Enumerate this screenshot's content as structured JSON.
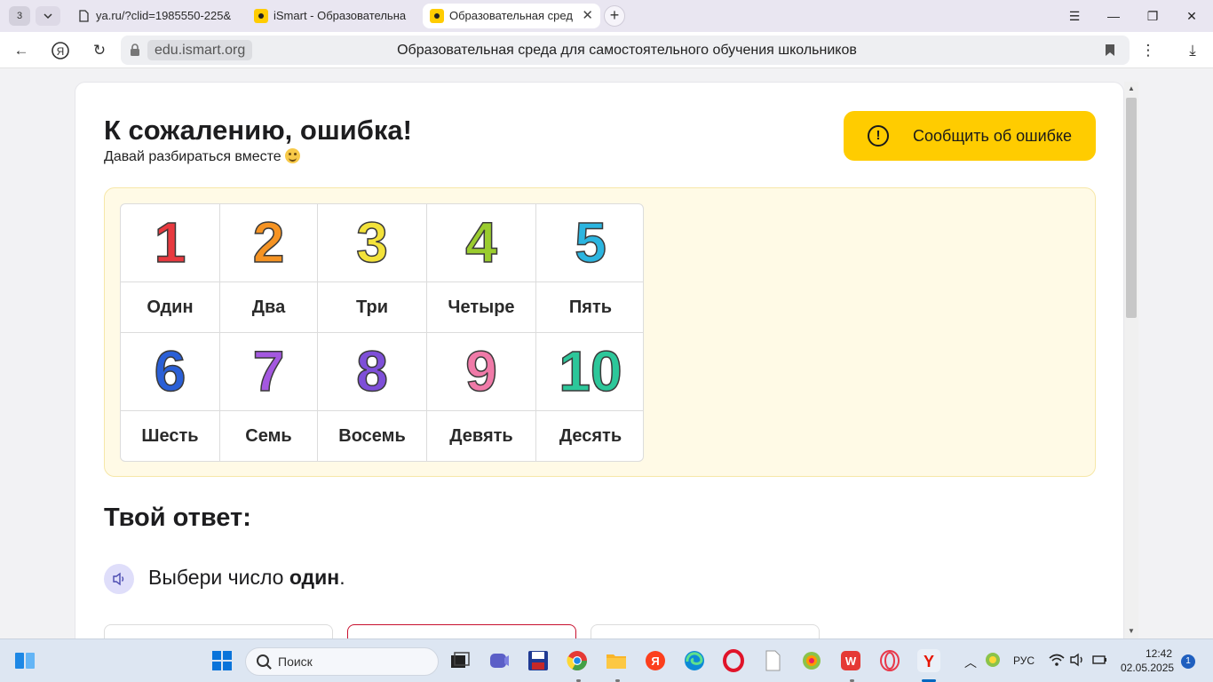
{
  "browser": {
    "tab_count": "3",
    "tabs": [
      {
        "label": "ya.ru/?clid=1985550-225&"
      },
      {
        "label": "iSmart - Образовательна"
      },
      {
        "label": "Образовательная сред"
      }
    ],
    "domain": "edu.ismart.org",
    "page_title": "Образовательная среда для самостоятельного обучения школьников"
  },
  "error": {
    "title": "К сожалению, ошибка!",
    "subtitle": "Давай разбираться вместе",
    "report_button": "Сообщить об ошибке"
  },
  "numbers": {
    "row1": [
      {
        "digit": "1",
        "word": "Один",
        "color": "#e8393f"
      },
      {
        "digit": "2",
        "word": "Два",
        "color": "#f59323"
      },
      {
        "digit": "3",
        "word": "Три",
        "color": "#f3e23a"
      },
      {
        "digit": "4",
        "word": "Четыре",
        "color": "#9acc2e"
      },
      {
        "digit": "5",
        "word": "Пять",
        "color": "#2bb5e0"
      }
    ],
    "row2": [
      {
        "digit": "6",
        "word": "Шесть",
        "color": "#2a5fd6"
      },
      {
        "digit": "7",
        "word": "Семь",
        "color": "#a458e0"
      },
      {
        "digit": "8",
        "word": "Восемь",
        "color": "#7e4fd8"
      },
      {
        "digit": "9",
        "word": "Девять",
        "color": "#f07aa8"
      },
      {
        "digit": "10",
        "word": "Десять",
        "color": "#2cc79a"
      }
    ]
  },
  "answer": {
    "title": "Твой ответ:",
    "question_prefix": "Выбери число ",
    "question_bold": "один",
    "question_suffix": "."
  },
  "taskbar": {
    "search_label": "Поиск",
    "language": "РУС",
    "time": "12:42",
    "date": "02.05.2025",
    "notifications": "1"
  },
  "colors": {
    "accent_yellow": "#ffcc00",
    "selected_border": "#c8102e",
    "panel_bg": "#fffae6"
  }
}
